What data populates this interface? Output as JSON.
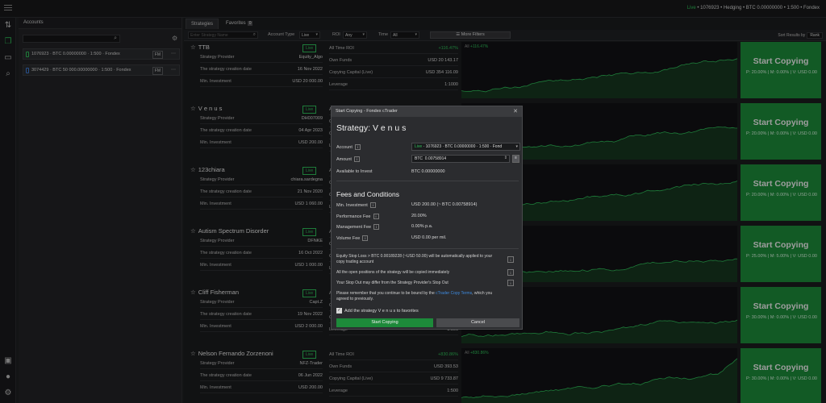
{
  "topbar": {
    "live": "Live",
    "account_info": "• 1076923 • Hedging • BTC 0.00000000 • 1:500 • Fondex"
  },
  "accounts": {
    "title": "Accounts",
    "items": [
      {
        "label": "1076923 · BTC 0.00000000 · 1:500 · Fondex",
        "badge": "FM",
        "type": "live"
      },
      {
        "label": "3074429 · BTC 50 000.00000000 · 1:500 · Fondex",
        "badge": "FM",
        "type": "demo"
      }
    ]
  },
  "tabs": [
    {
      "label": "Strategies"
    },
    {
      "label": "Favorites",
      "count": "0"
    }
  ],
  "filters": {
    "search_placeholder": "Enter Strategy Name",
    "account_type_label": "Account Type",
    "account_type_value": "Live",
    "roi_label": "ROI",
    "roi_value": "Any",
    "time_label": "Time",
    "time_value": "All",
    "more_filters": "More Filters",
    "sort_label": "Sort Results by",
    "sort_value": "Rank"
  },
  "row_labels": {
    "provider": "Strategy Provider",
    "created": "The strategy creation date",
    "min": "Min. Investment",
    "roi": "All Time ROI",
    "own": "Own Funds",
    "capital": "Copying Capital (Live)",
    "leverage": "Leverage",
    "live_badge": "Live",
    "copy": "Start Copying",
    "all": "All"
  },
  "strategies": [
    {
      "name": "TTB",
      "provider": "Equity_Algo",
      "created": "16 Nov 2022",
      "min": "USD 20 000.00",
      "roi": "+116.47%",
      "own": "USD 20 143.17",
      "capital": "USD 354 116.09",
      "leverage": "1:1000",
      "perf": "P: 20.00% | M: 0.00% | V: USD 0.00",
      "chart_roi": "+116.47%"
    },
    {
      "name": "V e n u s",
      "provider": "DH007009",
      "created": "04 Apr 2023",
      "min": "USD 200.00",
      "roi": "",
      "own": "",
      "capital": "",
      "leverage": "",
      "perf": "P: 20.00% | M: 0.00% | V: USD 0.00",
      "chart_roi": ""
    },
    {
      "name": "123chiara",
      "provider": "chiara.sardegna",
      "created": "21 Nov 2020",
      "min": "USD 1 060.00",
      "roi": "",
      "own": "",
      "capital": "",
      "leverage": "",
      "perf": "P: 20.00% | M: 0.00% | V: USD 0.00",
      "chart_roi": ""
    },
    {
      "name": "Autism Spectrum Disorder",
      "provider": "DFNKE",
      "created": "16 Oct 2022",
      "min": "USD 1 000.00",
      "roi": "",
      "own": "",
      "capital": "",
      "leverage": "",
      "perf": "P: 25.00% | M: 5.00% | V: USD 0.00",
      "chart_roi": ""
    },
    {
      "name": "Cliff Fisherman",
      "provider": "Capt.Z",
      "created": "19 Nov 2022",
      "min": "USD 2 000.00",
      "roi": "",
      "own": "",
      "capital": "",
      "leverage": "1:500",
      "perf": "P: 30.00% | M: 0.00% | V: USD 0.00",
      "chart_roi": ""
    },
    {
      "name": "Nelson Fernando Zorzenoni",
      "provider": "NFZ-Trader",
      "created": "06 Jun 2022",
      "min": "USD 200.00",
      "roi": "+830.86%",
      "own": "USD 393.53",
      "capital": "USD 9 733.87",
      "leverage": "1:500",
      "perf": "P: 30.00% | M: 0.00% | V: USD 0.00",
      "chart_roi": "+830.86%"
    }
  ],
  "modal": {
    "title": "Start Copying - Fondex cTrader",
    "heading": "Strategy: V e n u s",
    "account_label": "Account",
    "account_live": "Live",
    "account_value": "· 1076923 · BTC 0.00000000 · 1:500 · Fond",
    "amount_label": "Amount",
    "amount_currency": "BTC",
    "amount_value": "0.00758914",
    "available_label": "Available to Invest",
    "available_value": "BTC 0.00000000",
    "fees_heading": "Fees and Conditions",
    "min_label": "Min. Investment",
    "min_value": "USD 200.00 (~ BTC 0.00758914)",
    "perf_label": "Performance Fee",
    "perf_value": "20.00%",
    "mgmt_label": "Management Fee",
    "mgmt_value": "0.00% p.a.",
    "vol_label": "Volume Fee",
    "vol_value": "USD 0.00 per mil.",
    "note1": "Equity Stop Loss > BTC 0.00189228 (~USD 50.00) will be automatically applied to your copy trading account",
    "note2": "All the open positions of the strategy will be copied immediately",
    "note3": "Your Stop Out may differ from the Strategy Provider's Stop Out",
    "note4_a": "Please remember that you continue to be bound by the",
    "note4_link": "cTrader Copy Terms",
    "note4_b": ", which you agreed to previously.",
    "favorites": "Add the strategy V e n u s to favorites",
    "start": "Start Copying",
    "cancel": "Cancel"
  }
}
